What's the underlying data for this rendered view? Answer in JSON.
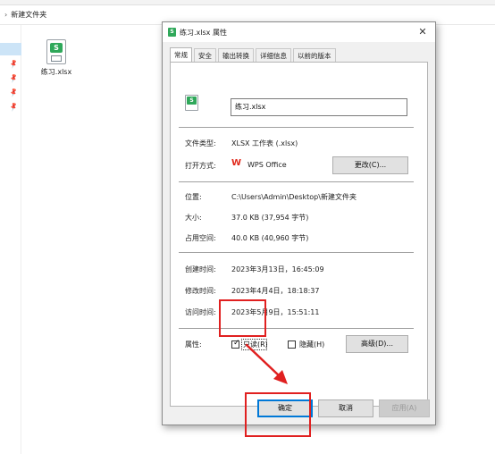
{
  "explorer": {
    "breadcrumb_chevron": "›",
    "breadcrumb_folder": "新建文件夹",
    "file_name": "练习.xlsx",
    "file_badge": "S"
  },
  "dialog": {
    "title": "练习.xlsx 属性",
    "close_glyph": "✕",
    "tabs": [
      "常规",
      "安全",
      "输出转换",
      "详细信息",
      "以前的版本"
    ],
    "name_value": "练习.xlsx",
    "file_type_label": "文件类型:",
    "file_type_value": "XLSX 工作表 (.xlsx)",
    "open_with_label": "打开方式:",
    "open_with_value": "WPS Office",
    "change_button": "更改(C)...",
    "location_label": "位置:",
    "location_value": "C:\\Users\\Admin\\Desktop\\新建文件夹",
    "size_label": "大小:",
    "size_value": "37.0 KB (37,954 字节)",
    "size_on_disk_label": "占用空间:",
    "size_on_disk_value": "40.0 KB (40,960 字节)",
    "created_label": "创建时间:",
    "created_value": "2023年3月13日，16:45:09",
    "modified_label": "修改时间:",
    "modified_value": "2023年4月4日，18:18:37",
    "accessed_label": "访问时间:",
    "accessed_value": "2023年5月9日，15:51:11",
    "attributes_label": "属性:",
    "readonly_label": "只读(R)",
    "readonly_checked": true,
    "hidden_label": "隐藏(H)",
    "hidden_checked": false,
    "advanced_button": "高级(D)...",
    "ok_button": "确定",
    "cancel_button": "取消",
    "apply_button": "应用(A)",
    "check_glyph": "✓"
  },
  "colors": {
    "highlight_red": "#e02020",
    "excel_green": "#2fa85a",
    "wps_red": "#e0291b",
    "selection_blue": "#cce4f7"
  }
}
